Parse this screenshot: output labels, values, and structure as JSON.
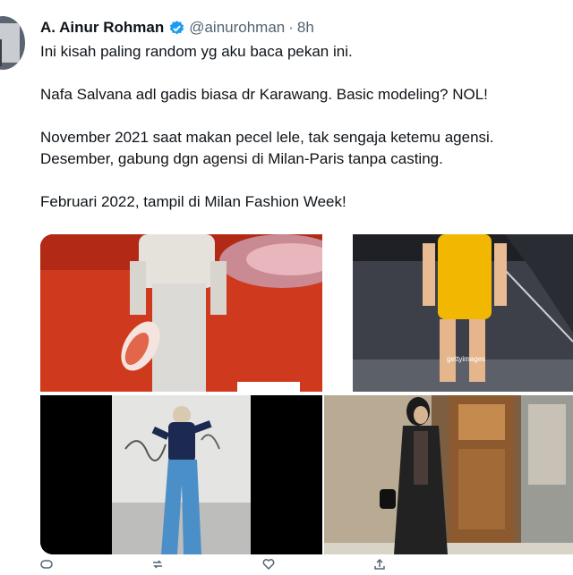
{
  "tweet": {
    "author_name": "A. Ainur Rohman",
    "handle": "@ainurohman",
    "separator": "·",
    "time": "8h",
    "lines": [
      "Ini kisah paling random yg aku baca pekan ini.",
      "Nafa Salvana adl gadis biasa dr Karawang. Basic modeling? NOL!",
      "November 2021 saat makan pecel lele, tak sengaja ketemu agensi.",
      "Desember, gabung dgn agensi di Milan-Paris tanpa casting.",
      "Februari 2022, tampil di Milan Fashion Week!"
    ]
  },
  "media": {
    "watermark": "gettyimages",
    "photos": [
      "runway-red-carpet-photo",
      "yellow-dress-runway-photo",
      "blue-jeans-street-photo",
      "black-coat-street-photo"
    ]
  },
  "colors": {
    "verified": "#1d9bf0",
    "secondary_text": "#536471"
  }
}
